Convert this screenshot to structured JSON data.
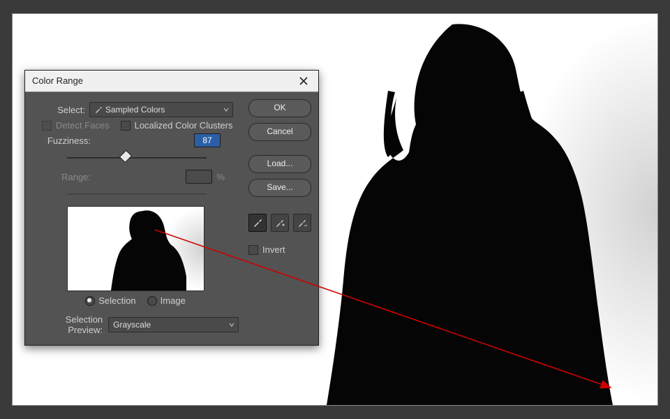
{
  "dialog": {
    "title": "Color Range",
    "select_label": "Select:",
    "select_value": "Sampled Colors",
    "detect_faces_label": "Detect Faces",
    "detect_faces_enabled": false,
    "localized_label": "Localized Color Clusters",
    "localized_checked": false,
    "fuzziness_label": "Fuzziness:",
    "fuzziness_value": "87",
    "range_label": "Range:",
    "range_value": "",
    "range_unit": "%",
    "radio_selection": "Selection",
    "radio_image": "Image",
    "selection_preview_label": "Selection Preview:",
    "selection_preview_value": "Grayscale",
    "buttons": {
      "ok": "OK",
      "cancel": "Cancel",
      "load": "Load...",
      "save": "Save..."
    },
    "invert_label": "Invert",
    "invert_checked": false
  }
}
